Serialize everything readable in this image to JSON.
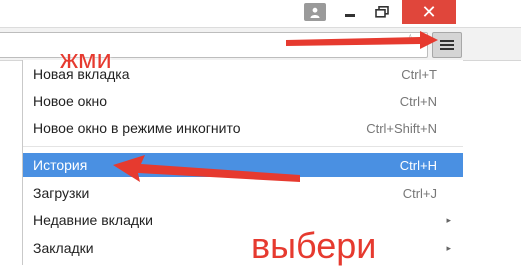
{
  "window": {
    "close_glyph": "✕",
    "min_glyph": "—",
    "max_glyph": "❐"
  },
  "toolbar": {
    "star_glyph": "☆",
    "menu_icon": "hamburger-icon"
  },
  "menu": {
    "items": [
      {
        "label": "Новая вкладка",
        "shortcut": "Ctrl+T"
      },
      {
        "label": "Новое окно",
        "shortcut": "Ctrl+N"
      },
      {
        "label": "Новое окно в режиме инкогнито",
        "shortcut": "Ctrl+Shift+N"
      },
      {
        "label": "История",
        "shortcut": "Ctrl+H"
      },
      {
        "label": "Загрузки",
        "shortcut": "Ctrl+J"
      },
      {
        "label": "Недавние вкладки",
        "shortcut": ""
      },
      {
        "label": "Закладки",
        "shortcut": ""
      }
    ],
    "submenu_arrow": "▸",
    "selected_color": "#4a90e2"
  },
  "annotations": {
    "press": "жми",
    "choose": "выбери",
    "color": "#e63a2f"
  }
}
